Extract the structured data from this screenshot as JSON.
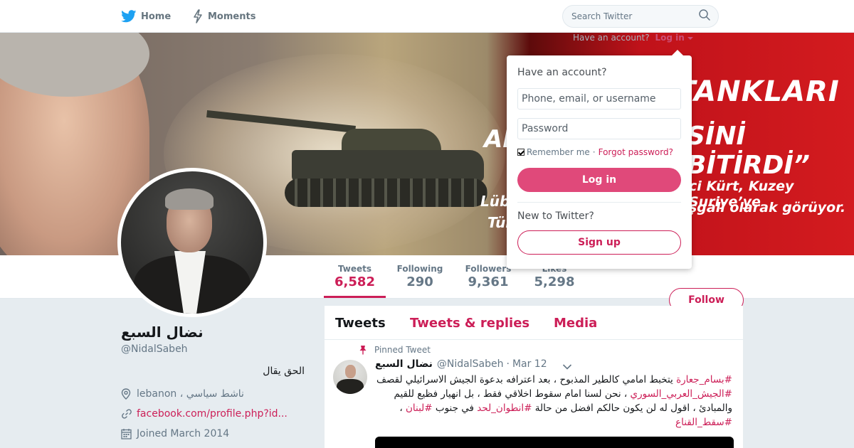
{
  "nav": {
    "home_label": "Home",
    "moments_label": "Moments",
    "search_placeholder": "Search Twitter"
  },
  "banner": {
    "line1": "TANKLARI",
    "line2": "AF",
    "line3": "SİNİ BİTİRDİ”",
    "line4": "Lübn",
    "line5": "Tür",
    "line6": "ci Kürt, Kuzey Suriye’ye",
    "line7": "şgali olarak görüyor."
  },
  "login_prompt": {
    "have_account": "Have an account?",
    "login_link": "Log in"
  },
  "login_box": {
    "heading": "Have an account?",
    "username_placeholder": "Phone, email, or username",
    "password_placeholder": "Password",
    "remember_label": "Remember me",
    "separator": "·",
    "forgot_label": "Forgot password?",
    "login_button": "Log in",
    "new_label": "New to Twitter?",
    "signup_button": "Sign up"
  },
  "stats": {
    "tweets_label": "Tweets",
    "tweets_value": "6,582",
    "following_label": "Following",
    "following_value": "290",
    "followers_label": "Followers",
    "followers_value": "9,361",
    "likes_label": "Likes",
    "likes_value": "5,298"
  },
  "follow_button": "Follow",
  "profile": {
    "name": "نضال السبع",
    "handle": "@NidalSabeh",
    "bio": "الحق يقال",
    "location": "lebanon ، ناشط سياسي",
    "url": "facebook.com/profile.php?id...",
    "joined": "Joined March 2014"
  },
  "tabs": {
    "tweets": "Tweets",
    "replies": "Tweets & replies",
    "media": "Media"
  },
  "tweet": {
    "pinned_label": "Pinned Tweet",
    "name": "نضال السبع",
    "handle": "@NidalSabeh",
    "separator": "·",
    "date": "Mar 12",
    "hashtag1": "#بسام_جعارة",
    "text1": " يتخبط امامي كالطير المذبوح ، بعد اعترافه بدعوة الجيش الاسرائيلي لقصف ",
    "hashtag2": "#الجيش_العربي_السوري",
    "text2": " ، نحن لسنا امام سقوط اخلاقي فقط ، بل انهيار فظيع للقيم والمبادئ ، اقول له لن يكون حالكم افضل من حالة ",
    "hashtag3": "#انطوان_لحد",
    "text3": " في جنوب ",
    "hashtag4": "#لبنان",
    "text4": " ، ",
    "hashtag5": "#سقط_القناع"
  },
  "colors": {
    "accent": "#cc1e57",
    "login_button": "#e0497a",
    "nav_text": "#66757f",
    "background": "#e6ecf0"
  },
  "icons": {
    "nav_home": "twitter-bird-icon",
    "nav_moments": "lightning-icon",
    "search": "search-icon",
    "location": "location-pin-icon",
    "url": "link-icon",
    "joined": "calendar-icon",
    "pinned": "pin-icon",
    "tweet_menu": "chevron-down-icon"
  }
}
